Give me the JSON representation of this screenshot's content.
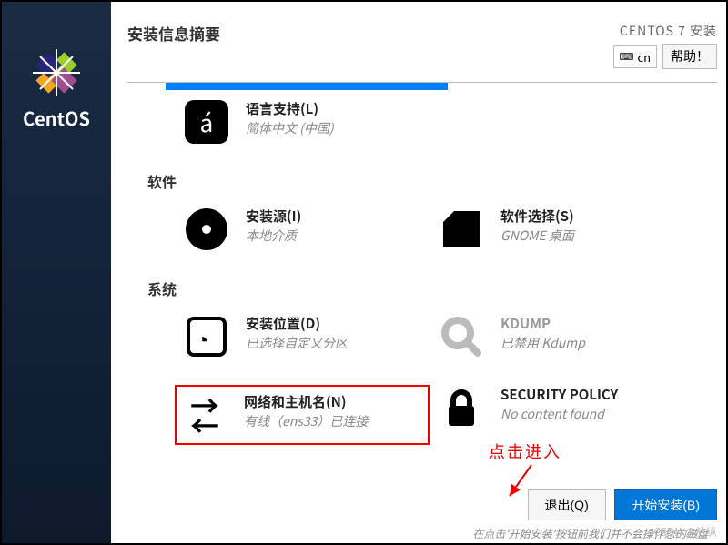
{
  "sidebar": {
    "brand": "CentOS"
  },
  "header": {
    "title": "安装信息摘要",
    "installer": "CENTOS 7 安装",
    "keyboard": "cn",
    "help_label": "帮助！"
  },
  "spokes": {
    "language": {
      "title": "语言支持(L)",
      "status": "简体中文 (中国)",
      "icon": "language-icon"
    },
    "section_software": "软件",
    "source": {
      "title": "安装源(I)",
      "status": "本地介质",
      "icon": "disc-icon"
    },
    "selection": {
      "title": "软件选择(S)",
      "status": "GNOME 桌面",
      "icon": "package-icon"
    },
    "section_system": "系统",
    "destination": {
      "title": "安装位置(D)",
      "status": "已选择自定义分区",
      "icon": "hdd-icon"
    },
    "kdump": {
      "title": "KDUMP",
      "status": "已禁用 Kdump",
      "icon": "search-icon"
    },
    "network": {
      "title": "网络和主机名(N)",
      "status": "有线（ens33）已连接",
      "icon": "network-icon"
    },
    "security": {
      "title": "SECURITY POLICY",
      "status": "No content found",
      "icon": "lock-icon"
    }
  },
  "annotation": {
    "text": "点击进入"
  },
  "actions": {
    "quit": "退出(Q)",
    "begin": "开始安装(B)"
  },
  "bottom_hint": "在点击'开始安装'按钮前我们并不会操作您的磁盘",
  "watermark": "CSDN @放纵"
}
